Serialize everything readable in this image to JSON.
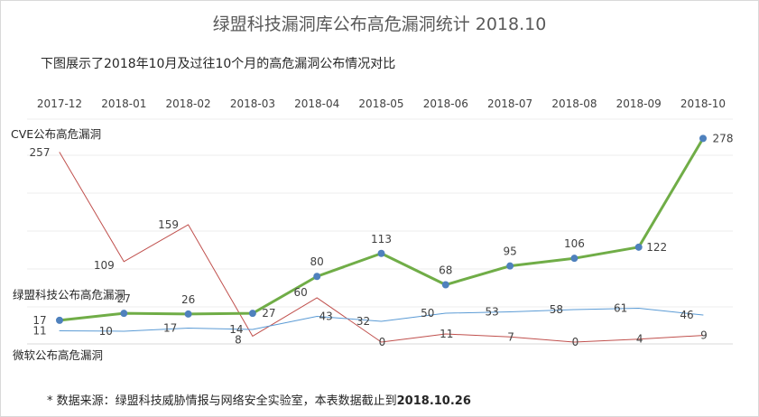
{
  "chart_data": {
    "type": "line",
    "title": "绿盟科技漏洞库公布高危漏洞统计 2018.10",
    "subtitle": "下图展示了2018年10月及过往10个月的高危漏洞公布情况对比",
    "categories": [
      "2017-12",
      "2018-01",
      "2018-02",
      "2018-03",
      "2018-04",
      "2018-05",
      "2018-06",
      "2018-07",
      "2018-08",
      "2018-09",
      "2018-10"
    ],
    "series": [
      {
        "name": "CVE公布高危漏洞",
        "color": "#c0504d",
        "values": [
          257,
          109,
          159,
          8,
          60,
          0,
          11,
          7,
          0,
          4,
          9
        ]
      },
      {
        "name": "绿盟科技公布高危漏洞",
        "color": "#70ad47",
        "values": [
          17,
          27,
          26,
          27,
          80,
          113,
          68,
          95,
          106,
          122,
          278
        ]
      },
      {
        "name": "微软公布高危漏洞",
        "color": "#5b9bd5",
        "values": [
          11,
          10,
          17,
          14,
          43,
          32,
          50,
          53,
          58,
          61,
          46
        ]
      }
    ],
    "grid": true,
    "x_axis_position": "top",
    "note": "* 数据来源：绿盟科技威胁情报与网络安全实验室，本表数据截止到",
    "note_date": "2018.10.26"
  }
}
